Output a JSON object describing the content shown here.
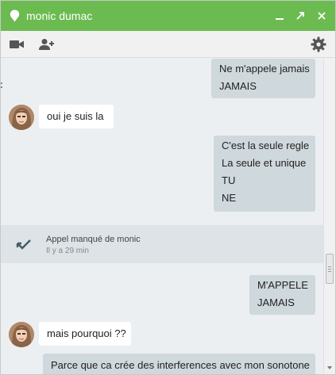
{
  "window": {
    "title": "monic dumac",
    "accent": "#6cbb51"
  },
  "titlebar": {
    "icons": [
      "location-pin-icon",
      "minimize-icon",
      "popout-icon",
      "close-icon"
    ]
  },
  "toolbar": {
    "icons": [
      "video-call-icon",
      "add-person-icon",
      "settings-gear-icon"
    ]
  },
  "messages": [
    {
      "direction": "out",
      "lines": [
        "Ne m'appele jamais",
        "JAMAIS"
      ]
    },
    {
      "direction": "in",
      "lines": [
        "oui je suis la"
      ]
    },
    {
      "direction": "out",
      "lines": [
        "C'est la seule regle",
        "La seule et unique",
        "TU",
        "NE"
      ]
    },
    {
      "direction": "out",
      "lines": [
        "M'APPELE",
        "JAMAIS"
      ]
    },
    {
      "direction": "in",
      "lines": [
        "mais pourquoi ??"
      ]
    },
    {
      "direction": "out",
      "lines": [
        "Parce que ca crée des interferences avec mon sonotone"
      ]
    }
  ],
  "missed_call": {
    "title": "Appel manqué de monic",
    "time": "Il y a 29 min",
    "icon": "missed-call-arrow-icon"
  },
  "colors": {
    "outgoing_bubble": "#cfd8dc",
    "incoming_bubble": "#ffffff",
    "chat_background": "#eceff1"
  }
}
